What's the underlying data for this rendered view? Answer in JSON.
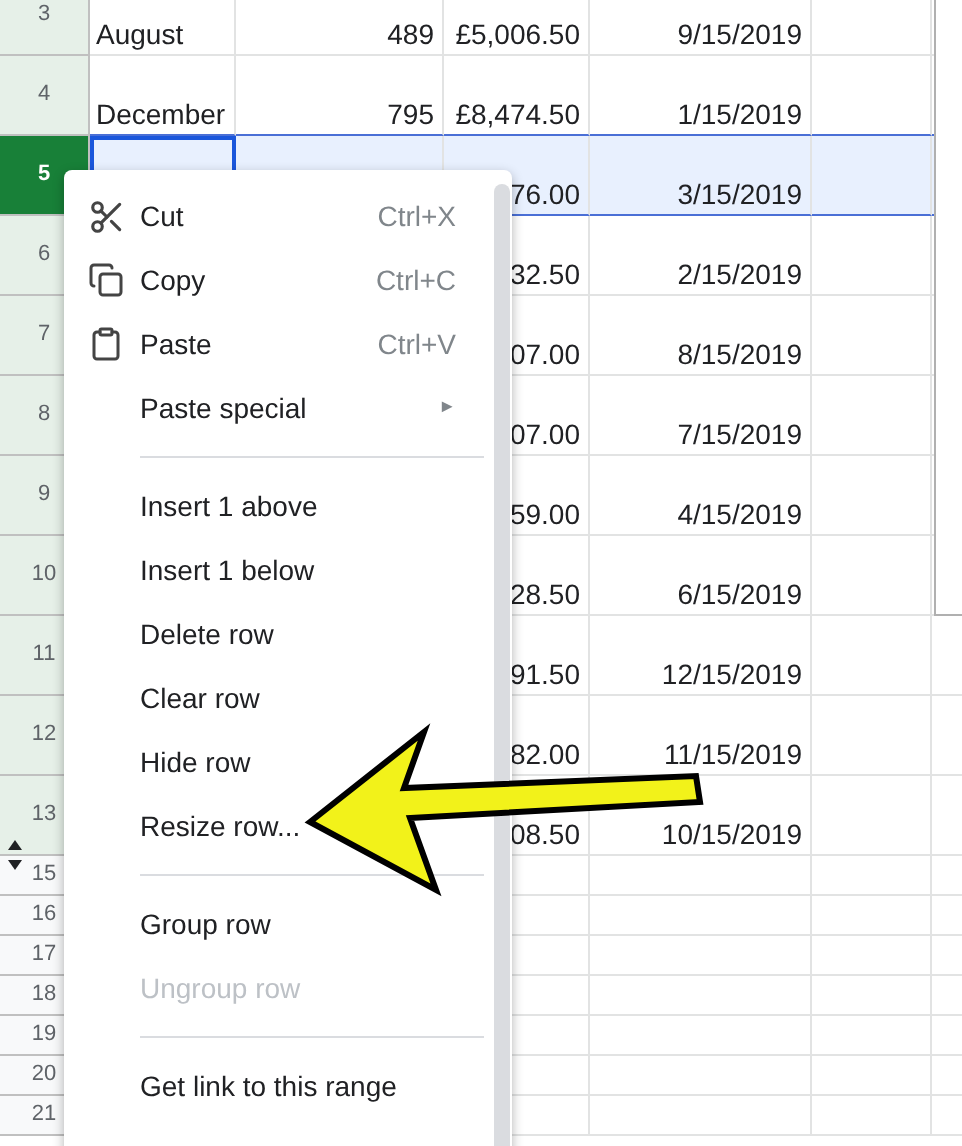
{
  "rows": [
    {
      "number": "3",
      "selected": false,
      "tinted": true,
      "cells": [
        "August",
        "489",
        "£5,006.50",
        "9/15/2019"
      ]
    },
    {
      "number": "4",
      "selected": false,
      "tinted": true,
      "cells": [
        "December",
        "795",
        "£8,474.50",
        "1/15/2019"
      ]
    },
    {
      "number": "5",
      "selected": true,
      "tinted": true,
      "cells": [
        "",
        "",
        "76.00",
        "3/15/2019"
      ]
    },
    {
      "number": "6",
      "selected": false,
      "tinted": true,
      "cells": [
        "",
        "",
        "32.50",
        "2/15/2019"
      ]
    },
    {
      "number": "7",
      "selected": false,
      "tinted": true,
      "cells": [
        "",
        "",
        "07.00",
        "8/15/2019"
      ]
    },
    {
      "number": "8",
      "selected": false,
      "tinted": true,
      "cells": [
        "",
        "",
        "07.00",
        "7/15/2019"
      ]
    },
    {
      "number": "9",
      "selected": false,
      "tinted": true,
      "cells": [
        "",
        "",
        "59.00",
        "4/15/2019"
      ]
    },
    {
      "number": "10",
      "selected": false,
      "tinted": true,
      "cells": [
        "",
        "",
        "28.50",
        "6/15/2019"
      ]
    },
    {
      "number": "11",
      "selected": false,
      "tinted": true,
      "cells": [
        "",
        "",
        "91.50",
        "12/15/2019"
      ]
    },
    {
      "number": "12",
      "selected": false,
      "tinted": true,
      "cells": [
        "",
        "",
        "82.00",
        "11/15/2019"
      ]
    },
    {
      "number": "13",
      "selected": false,
      "tinted": true,
      "hidden_rows_below": true,
      "cells": [
        "",
        "",
        "08.50",
        "10/15/2019"
      ]
    },
    {
      "number": "15",
      "selected": false,
      "tinted": false,
      "hidden_rows_above": true,
      "cells": [
        "",
        "",
        "",
        ""
      ]
    },
    {
      "number": "16",
      "selected": false,
      "tinted": false,
      "cells": [
        "",
        "",
        "",
        ""
      ]
    },
    {
      "number": "17",
      "selected": false,
      "tinted": false,
      "cells": [
        "",
        "",
        "",
        ""
      ]
    },
    {
      "number": "18",
      "selected": false,
      "tinted": false,
      "cells": [
        "",
        "",
        "",
        ""
      ]
    },
    {
      "number": "19",
      "selected": false,
      "tinted": false,
      "cells": [
        "",
        "",
        "",
        ""
      ]
    },
    {
      "number": "20",
      "selected": false,
      "tinted": false,
      "cells": [
        "",
        "",
        "",
        ""
      ]
    },
    {
      "number": "21",
      "selected": false,
      "tinted": false,
      "cells": [
        "",
        "",
        "",
        ""
      ]
    }
  ],
  "context_menu": [
    {
      "kind": "cut",
      "label": "Cut",
      "shortcut": "Ctrl+X",
      "disabled": false
    },
    {
      "kind": "copy",
      "label": "Copy",
      "shortcut": "Ctrl+C",
      "disabled": false
    },
    {
      "kind": "paste",
      "label": "Paste",
      "shortcut": "Ctrl+V",
      "disabled": false
    },
    {
      "kind": "item",
      "label": "Paste special",
      "submenu": "►",
      "disabled": false
    },
    {
      "kind": "divider"
    },
    {
      "kind": "item",
      "label": "Insert 1 above",
      "disabled": false
    },
    {
      "kind": "item",
      "label": "Insert 1 below",
      "disabled": false
    },
    {
      "kind": "item",
      "label": "Delete row",
      "disabled": false
    },
    {
      "kind": "item",
      "label": "Clear row",
      "disabled": false
    },
    {
      "kind": "item",
      "label": "Hide row",
      "disabled": false
    },
    {
      "kind": "item",
      "label": "Resize row...",
      "disabled": false
    },
    {
      "kind": "divider"
    },
    {
      "kind": "item",
      "label": "Group row",
      "disabled": false
    },
    {
      "kind": "item",
      "label": "Ungroup row",
      "disabled": true
    },
    {
      "kind": "divider"
    },
    {
      "kind": "item",
      "label": "Get link to this range",
      "disabled": false
    }
  ]
}
